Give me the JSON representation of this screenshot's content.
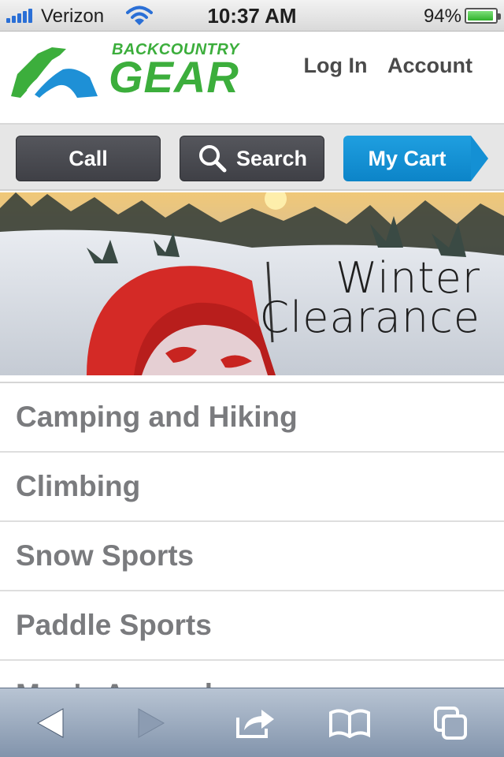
{
  "status_bar": {
    "carrier": "Verizon",
    "time": "10:37 AM",
    "battery_percent": "94%",
    "battery_level": 0.94,
    "icons": [
      "signal-bars-icon",
      "wifi-icon",
      "battery-icon"
    ]
  },
  "header": {
    "logo_top": "BACKCOUNTRY",
    "logo_main": "GEAR",
    "login_label": "Log In",
    "account_label": "Account",
    "colors": {
      "logo_green": "#3cae3c",
      "logo_blue": "#1e90d6"
    }
  },
  "action_bar": {
    "call_label": "Call",
    "search_label": "Search",
    "cart_label": "My Cart",
    "colors": {
      "dark_button": "#46474d",
      "cart_button": "#1490d4"
    }
  },
  "banner": {
    "line1": "Winter",
    "line2": "Clearance"
  },
  "categories": [
    {
      "label": "Camping and Hiking"
    },
    {
      "label": "Climbing"
    },
    {
      "label": "Snow Sports"
    },
    {
      "label": "Paddle Sports"
    },
    {
      "label": "Men's Apparel"
    }
  ],
  "toolbar": {
    "icons": [
      "back-arrow-icon",
      "forward-arrow-icon",
      "share-icon",
      "bookmarks-icon",
      "tabs-icon"
    ]
  }
}
